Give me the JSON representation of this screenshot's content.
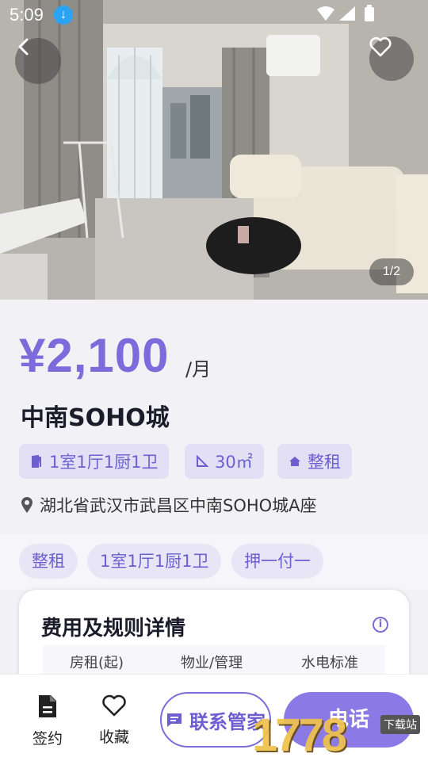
{
  "status_bar": {
    "time": "5:09"
  },
  "hero": {
    "image_counter": "1/2"
  },
  "listing": {
    "price": "¥2,100",
    "price_unit": "/月",
    "title": "中南SOHO城",
    "specs": [
      "1室1厅1厨1卫",
      "30㎡",
      "整租"
    ],
    "address": "湖北省武汉市武昌区中南SOHO城A座"
  },
  "labels": [
    "整租",
    "1室1厅1厨1卫",
    "押一付一"
  ],
  "fee_card": {
    "title": "费用及规则详情",
    "columns": [
      "房租(起)",
      "物业/管理",
      "水电标准"
    ]
  },
  "bottom_bar": {
    "sign_label": "签约",
    "favorite_label": "收藏",
    "contact_label": "联系管家",
    "call_label": "电话"
  },
  "watermark": {
    "text": "1778",
    "badge": "下载站"
  },
  "colors": {
    "accent": "#7d6bdb",
    "tag_bg": "#e3e0f5",
    "call_button": "#8b79e6"
  }
}
